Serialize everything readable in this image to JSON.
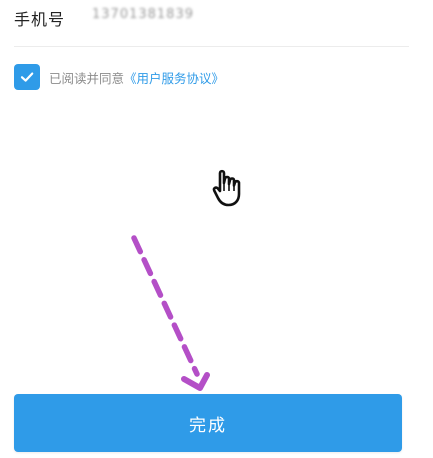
{
  "form": {
    "phone_label": "手机号",
    "phone_value": "13701381839"
  },
  "agreement": {
    "checked": true,
    "text": "已阅读并同意",
    "link": "《用户服务协议》"
  },
  "actions": {
    "complete_label": "完成"
  },
  "colors": {
    "accent": "#2f9be8",
    "annotation": "#b44fc7"
  },
  "icons": {
    "checkbox": "checkmark-icon",
    "cursor": "hand-cursor-icon",
    "arrow": "dashed-arrow-annotation"
  }
}
